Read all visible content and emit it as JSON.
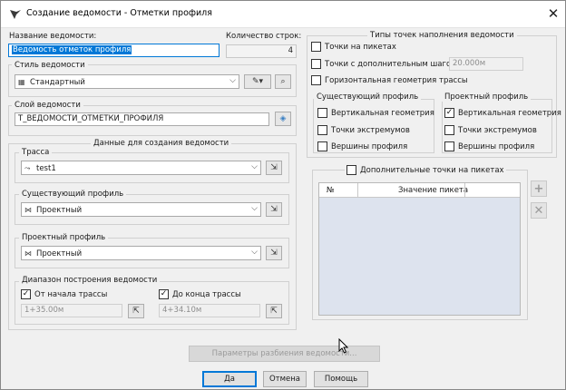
{
  "window": {
    "title": "Создание ведомости - Отметки профиля",
    "close_glyph": "✕",
    "app_icon": "civil-app-icon"
  },
  "name_section": {
    "name_label": "Название ведомости:",
    "name_value": "Ведомость отметок профиля",
    "rows_label": "Количество строк:",
    "rows_value": "4"
  },
  "style_section": {
    "label": "Стиль ведомости",
    "value": "Стандартный"
  },
  "layer_section": {
    "label": "Слой ведомости",
    "value": "Т_ВЕДОМОСТИ_ОТМЕТКИ_ПРОФИЛЯ"
  },
  "data_section": {
    "title": "Данные для создания ведомости",
    "route_label": "Трасса",
    "route_value": "test1",
    "existing_label": "Существующий профиль",
    "existing_value": "Проектный",
    "design_label": "Проектный профиль",
    "design_value": "Проектный",
    "range_title": "Диапазон построения ведомости",
    "from_start_label": "От начала трассы",
    "from_start_checked": true,
    "from_value": "1+35.00м",
    "to_end_label": "До конца трассы",
    "to_end_checked": true,
    "to_value": "4+34.10м"
  },
  "types_section": {
    "title": "Типы точек наполнения ведомости",
    "pickets_label": "Точки на пикетах",
    "pickets_checked": false,
    "extra_step_label": "Точки с дополнительным шагом:",
    "extra_step_checked": false,
    "extra_step_value": "20.000м",
    "horizontal_label": "Горизонтальная геометрия трассы",
    "horizontal_checked": false,
    "existing_title": "Существующий профиль",
    "existing_vertical": "Вертикальная геометрия",
    "existing_extrema": "Точки экстремумов",
    "existing_peaks": "Вершины профиля",
    "design_title": "Проектный профиль",
    "design_vertical": "Вертикальная геометрия",
    "design_vertical_checked": true,
    "design_extrema": "Точки экстремумов",
    "design_peaks": "Вершины профиля"
  },
  "extra_points": {
    "label": "Дополнительные точки на пикетах",
    "checked": false,
    "col_num": "№",
    "col_value": "Значение пикета"
  },
  "footer": {
    "split_params": "Параметры разбиения ведомости...",
    "ok": "Да",
    "cancel": "Отмена",
    "help": "Помощь"
  }
}
